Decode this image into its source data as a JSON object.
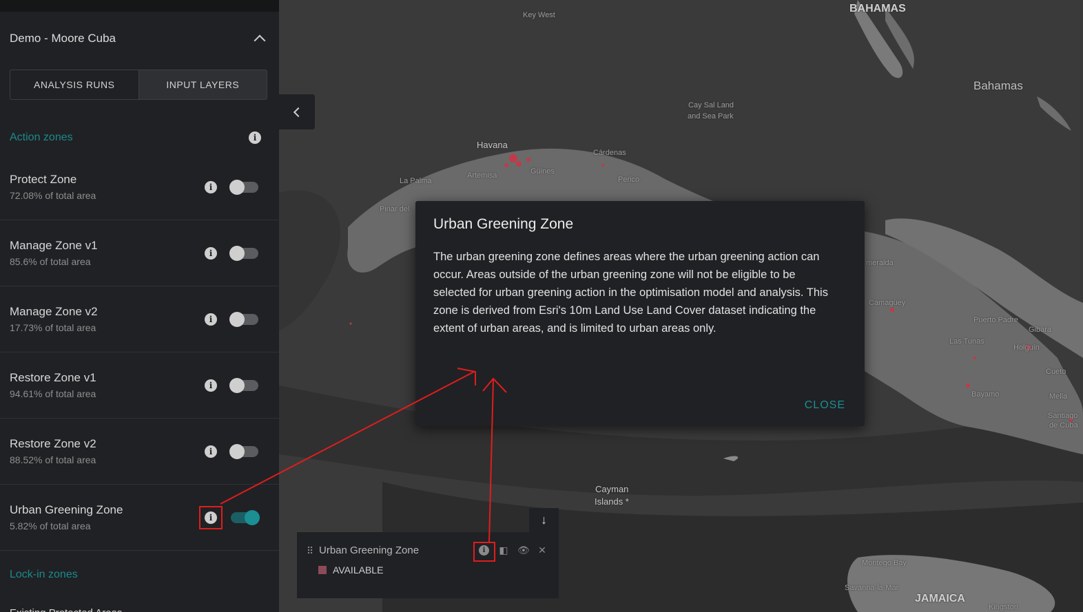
{
  "project": {
    "title": "Demo - Moore Cuba"
  },
  "tabs": [
    {
      "label": "ANALYSIS RUNS",
      "active": false
    },
    {
      "label": "INPUT LAYERS",
      "active": true
    }
  ],
  "sections": {
    "action_zones": {
      "title": "Action zones"
    },
    "lockin_zones": {
      "title": "Lock-in zones"
    }
  },
  "zones": [
    {
      "name": "Protect Zone",
      "area": "72.08% of total area",
      "enabled": false
    },
    {
      "name": "Manage Zone v1",
      "area": "85.6% of total area",
      "enabled": false
    },
    {
      "name": "Manage Zone v2",
      "area": "17.73% of total area",
      "enabled": false
    },
    {
      "name": "Restore Zone v1",
      "area": "94.61% of total area",
      "enabled": false
    },
    {
      "name": "Restore Zone v2",
      "area": "88.52% of total area",
      "enabled": false
    },
    {
      "name": "Urban Greening Zone",
      "area": "5.82% of total area",
      "enabled": true
    }
  ],
  "lockin": [
    {
      "name": "Existing Protected Areas"
    }
  ],
  "dialog": {
    "title": "Urban Greening Zone",
    "body": "The urban greening zone defines areas where the urban greening action can occur. Areas outside of the urban greening zone will not be eligible to be selected for urban greening action in the optimisation model and analysis. This zone is derived from Esri's 10m Land Use Land Cover dataset indicating the extent of urban areas, and is limited to urban areas only.",
    "close_label": "CLOSE"
  },
  "legend": {
    "layer_title": "Urban Greening Zone",
    "item_label": "AVAILABLE",
    "swatch_color": "#8c4b59"
  },
  "map_labels": {
    "key_west": "Key West",
    "bahamas_upper": "BAHAMAS",
    "bahamas": "Bahamas",
    "cay_sal_1": "Cay Sal Land",
    "cay_sal_2": "and Sea Park",
    "havana": "Havana",
    "cardenas": "Cárdenas",
    "artemisa": "Artemisa",
    "guines": "Güines",
    "la_palma": "La Palma",
    "perico": "Perico",
    "pinar": "Pinar del",
    "meralda": "meralda",
    "camaguey": "Camagüey",
    "puerto_padre": "Puerto Padre",
    "gibara": "Gibara",
    "las_tunas": "Las Tunas",
    "holguin": "Holguín",
    "cueto": "Cueto",
    "bayamo": "Bayamo",
    "mella": "Mella",
    "santiago_1": "Santiago",
    "santiago_2": "de Cuba",
    "cayman_1": "Cayman",
    "cayman_2": "Islands *",
    "montego": "Montego Bay",
    "savanna": "Savanna-la-Mar",
    "jamaica": "JAMAICA",
    "kingston": "Kingston"
  },
  "colors": {
    "accent": "#1b8f93",
    "panel": "#202124",
    "annotation": "#e01d1d"
  }
}
